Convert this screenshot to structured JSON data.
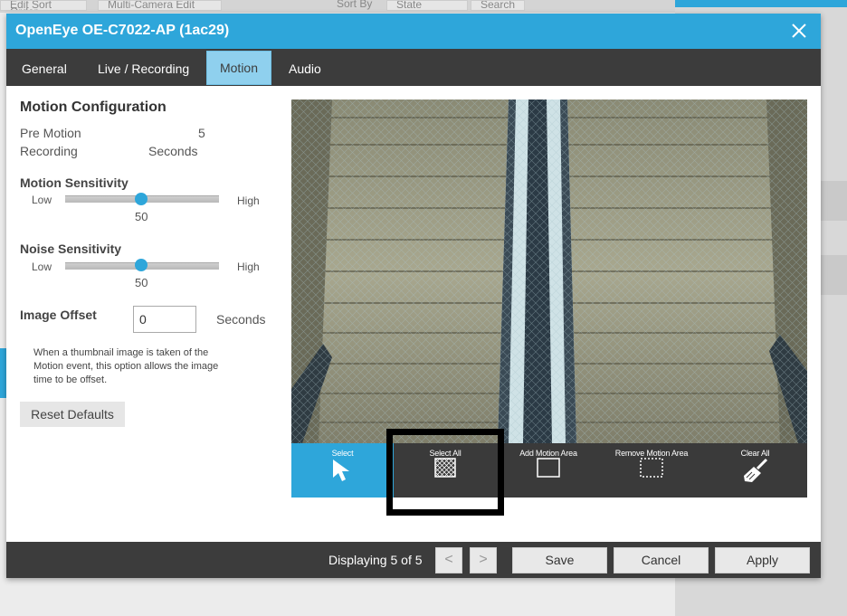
{
  "background": {
    "toolbar_buttons": [
      "Edit Sort Order",
      "Multi-Camera Edit",
      "Sort By",
      "State",
      "Search"
    ]
  },
  "modal": {
    "title": "OpenEye OE-C7022-AP (1ac29)",
    "tabs": [
      {
        "label": "General",
        "active": false
      },
      {
        "label": "Live / Recording",
        "active": false
      },
      {
        "label": "Motion",
        "active": true
      },
      {
        "label": "Audio",
        "active": false
      }
    ],
    "motion_config": {
      "heading": "Motion Configuration",
      "pre_motion_label_line1": "Pre Motion",
      "pre_motion_label_line2": "Recording",
      "pre_motion_value": "5",
      "pre_motion_unit": "Seconds",
      "motion_sensitivity": {
        "label": "Motion Sensitivity",
        "low": "Low",
        "high": "High",
        "value": "50",
        "fraction": 0.5
      },
      "noise_sensitivity": {
        "label": "Noise Sensitivity",
        "low": "Low",
        "high": "High",
        "value": "50",
        "fraction": 0.5
      },
      "image_offset": {
        "label": "Image Offset",
        "value": "0",
        "unit": "Seconds"
      },
      "help_text": "When a thumbnail image is taken of the Motion event, this option allows the image time to be offset.",
      "reset_label": "Reset Defaults"
    },
    "tools": [
      {
        "label": "Select",
        "icon": "cursor-arrow-icon",
        "selected": true
      },
      {
        "label": "Select All",
        "icon": "grid-square-icon",
        "selected": false
      },
      {
        "label": "Add Motion Area",
        "icon": "square-outline-icon",
        "selected": false
      },
      {
        "label": "Remove Motion Area",
        "icon": "dashed-square-icon",
        "selected": false
      },
      {
        "label": "Clear All",
        "icon": "broom-icon",
        "selected": false
      }
    ],
    "footer": {
      "displaying": "Displaying 5 of 5",
      "prev": "<",
      "next": ">",
      "save": "Save",
      "cancel": "Cancel",
      "apply": "Apply"
    }
  },
  "colors": {
    "accent": "#2ea6da",
    "dark_bar": "#3c3c3c"
  }
}
